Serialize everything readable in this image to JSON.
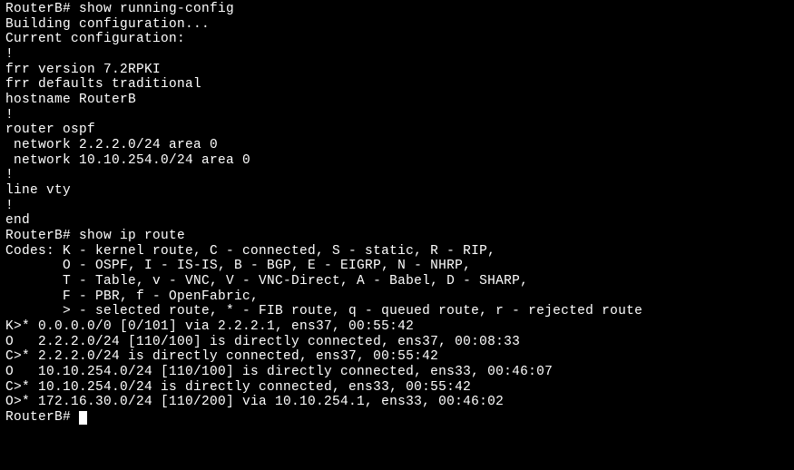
{
  "prompt_prefix": "RouterB# ",
  "lines": [
    "RouterB# show running-config",
    "Building configuration...",
    "",
    "Current configuration:",
    "!",
    "frr version 7.2RPKI",
    "frr defaults traditional",
    "hostname RouterB",
    "!",
    "router ospf",
    " network 2.2.2.0/24 area 0",
    " network 10.10.254.0/24 area 0",
    "!",
    "line vty",
    "!",
    "end",
    "RouterB# show ip route",
    "Codes: K - kernel route, C - connected, S - static, R - RIP,",
    "       O - OSPF, I - IS-IS, B - BGP, E - EIGRP, N - NHRP,",
    "       T - Table, v - VNC, V - VNC-Direct, A - Babel, D - SHARP,",
    "       F - PBR, f - OpenFabric,",
    "       > - selected route, * - FIB route, q - queued route, r - rejected route",
    "",
    "K>* 0.0.0.0/0 [0/101] via 2.2.2.1, ens37, 00:55:42",
    "O   2.2.2.0/24 [110/100] is directly connected, ens37, 00:08:33",
    "C>* 2.2.2.0/24 is directly connected, ens37, 00:55:42",
    "O   10.10.254.0/24 [110/100] is directly connected, ens33, 00:46:07",
    "C>* 10.10.254.0/24 is directly connected, ens33, 00:55:42",
    "O>* 172.16.30.0/24 [110/200] via 10.10.254.1, ens33, 00:46:02"
  ],
  "final_prompt": "RouterB# "
}
